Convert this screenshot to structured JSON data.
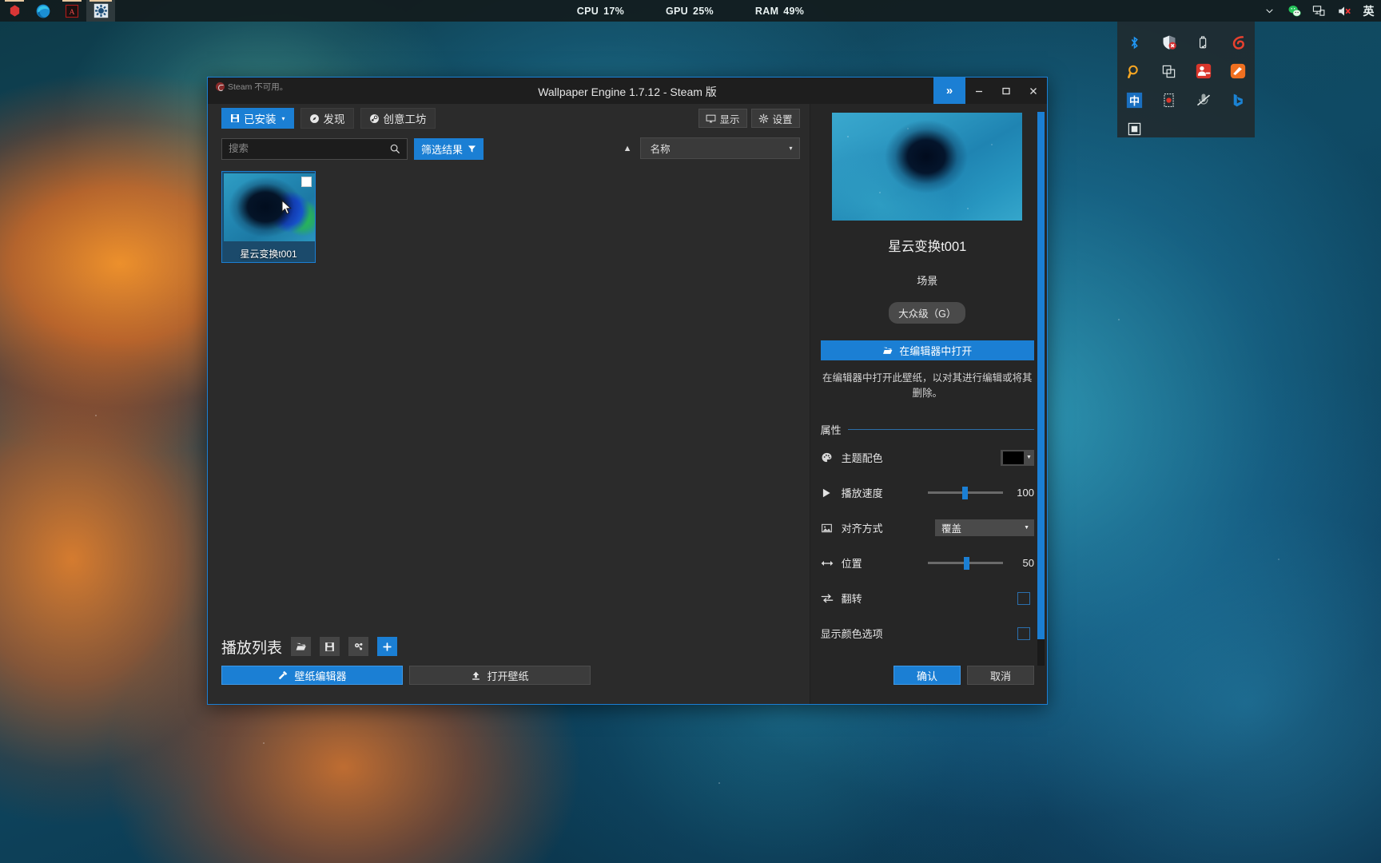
{
  "taskbar": {
    "apps": [
      {
        "name": "unity-icon",
        "label": ""
      },
      {
        "name": "edge-icon",
        "label": ""
      },
      {
        "name": "acrobat-icon",
        "label": ""
      },
      {
        "name": "wallpaper-engine-icon",
        "label": ""
      }
    ],
    "performance": [
      {
        "label": "CPU",
        "value": "17%"
      },
      {
        "label": "GPU",
        "value": "25%"
      },
      {
        "label": "RAM",
        "value": "49%"
      }
    ],
    "tray_visible": [
      "chevron-up-icon",
      "wechat-icon",
      "network-icon",
      "volume-muted-icon",
      "ime-english-icon"
    ],
    "ime_label": "英"
  },
  "tray_flyout": {
    "items": [
      "bluetooth-icon",
      "windows-defender-icon",
      "usb-eject-icon",
      "360-security-icon",
      "everything-search-icon",
      "clipboard-icon",
      "qq-group-icon",
      "orange-app-icon",
      "ime-chinese-icon",
      "screen-recorder-icon",
      "microphone-muted-icon",
      "bing-icon",
      "snip-tool-icon"
    ],
    "ime_chinese_label": "中"
  },
  "window": {
    "steam_status": "Steam 不可用。",
    "title": "Wallpaper Engine 1.7.12 - Steam 版",
    "controls": {
      "expand": "»",
      "minimize": "—",
      "maximize": "□",
      "close": "✕"
    }
  },
  "tabs": [
    {
      "label": "已安装",
      "icon": "save-icon",
      "active": true,
      "caret": "▾"
    },
    {
      "label": "发现",
      "icon": "compass-icon",
      "active": false
    },
    {
      "label": "创意工坊",
      "icon": "steam-icon",
      "active": false
    }
  ],
  "tools": [
    {
      "label": "显示",
      "icon": "monitor-icon"
    },
    {
      "label": "设置",
      "icon": "gear-icon"
    }
  ],
  "search": {
    "placeholder": "搜索",
    "value": "",
    "icon": "search-icon"
  },
  "filter": {
    "label": "筛选结果",
    "icon": "funnel-icon"
  },
  "sort": {
    "direction_icon": "▲",
    "value": "名称",
    "caret": "▾"
  },
  "grid": {
    "items": [
      {
        "name": "星云变换t001",
        "checked": false,
        "selected": true
      }
    ]
  },
  "playlist": {
    "title": "播放列表",
    "buttons": [
      {
        "name": "open-folder-button",
        "glyph": "🗀"
      },
      {
        "name": "save-playlist-button",
        "glyph": "🖫"
      },
      {
        "name": "playlist-settings-button",
        "glyph": "⚙"
      },
      {
        "name": "add-playlist-button",
        "glyph": "+"
      }
    ]
  },
  "bottom_left": [
    {
      "label": "壁纸编辑器",
      "icon": "tools-icon",
      "primary": true
    },
    {
      "label": "打开壁纸",
      "icon": "upload-icon",
      "primary": false
    }
  ],
  "details": {
    "title": "星云变换t001",
    "type": "场景",
    "rating": "大众级（G）",
    "open_button": {
      "label": "在编辑器中打开",
      "icon": "folder-icon"
    },
    "description": "在编辑器中打开此壁纸，以对其进行编辑或将其删除。",
    "properties_header": "属性",
    "properties": [
      {
        "name": "theme-color",
        "icon": "palette-icon",
        "label": "主题配色",
        "control": "color",
        "value": "#000000"
      },
      {
        "name": "playback-speed",
        "icon": "play-icon",
        "label": "播放速度",
        "control": "slider",
        "value": "100",
        "percent": 46
      },
      {
        "name": "alignment",
        "icon": "image-icon",
        "label": "对齐方式",
        "control": "select",
        "value": "覆盖"
      },
      {
        "name": "position",
        "icon": "arrows-lr-icon",
        "label": "位置",
        "control": "slider",
        "value": "50",
        "percent": 48
      },
      {
        "name": "flip",
        "icon": "swap-icon",
        "label": "翻转",
        "control": "checkbox",
        "checked": false
      },
      {
        "name": "show-color-options",
        "icon": "",
        "label": "显示颜色选项",
        "control": "checkbox",
        "checked": false
      }
    ]
  },
  "bottom_right": [
    {
      "label": "确认",
      "primary": true
    },
    {
      "label": "取消",
      "primary": false
    }
  ]
}
